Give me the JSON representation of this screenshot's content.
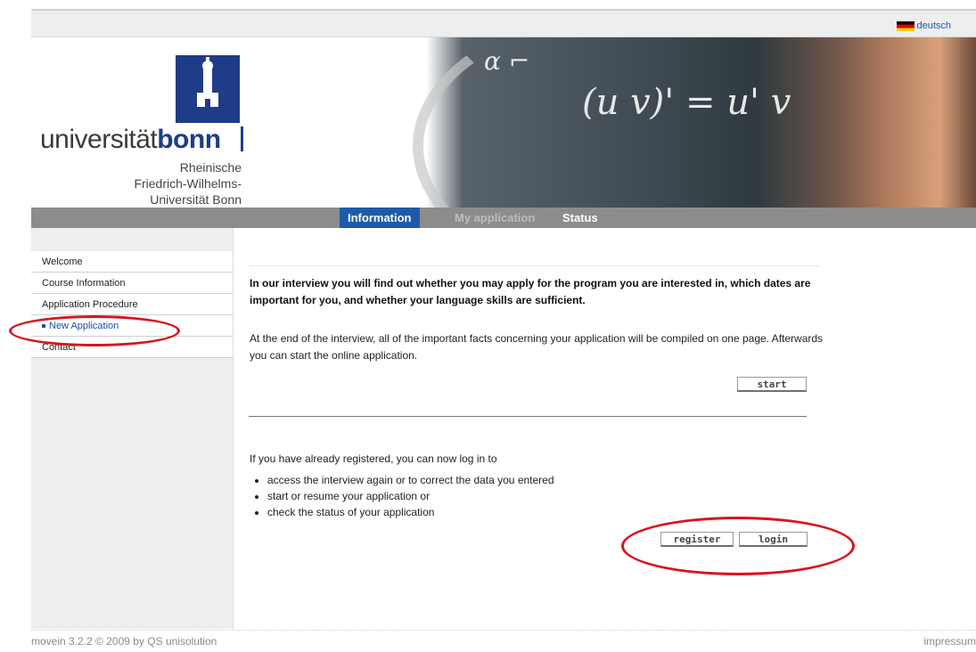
{
  "topbar": {
    "language_link": "deutsch"
  },
  "logo": {
    "wordmark_regular": "universität",
    "wordmark_bold": "bonn",
    "subline": [
      "Rheinische",
      "Friedrich-Wilhelms-",
      "Universität Bonn"
    ]
  },
  "nav": {
    "tabs": [
      "Information",
      "My application",
      "Status"
    ]
  },
  "sidebar": {
    "items": [
      "Welcome",
      "Course Information",
      "Application Procedure",
      "New Application",
      "Contact"
    ]
  },
  "main": {
    "intro_bold": "In our interview you will find out whether you may apply for the program you are interested in, which dates are important for you, and whether your language skills are sufficient.",
    "intro_text": "At the end of the interview, all of the important facts concerning your application will be compiled on one page. Afterwards you can start the online application.",
    "start_label": "start",
    "login_intro": "If you have already registered, you can now log in to",
    "login_bullets": [
      "access the interview again or to correct the data you entered",
      "start or resume your application or",
      "check the status of your application"
    ],
    "register_label": "register",
    "login_label": "login"
  },
  "footer": {
    "left_prefix": "movein 3.2.2 © 2009 by",
    "left_link": "QS unisolution",
    "right": "impressum"
  },
  "colors": {
    "accent": "#1e5aa8",
    "highlight_oval": "#d8141f"
  }
}
